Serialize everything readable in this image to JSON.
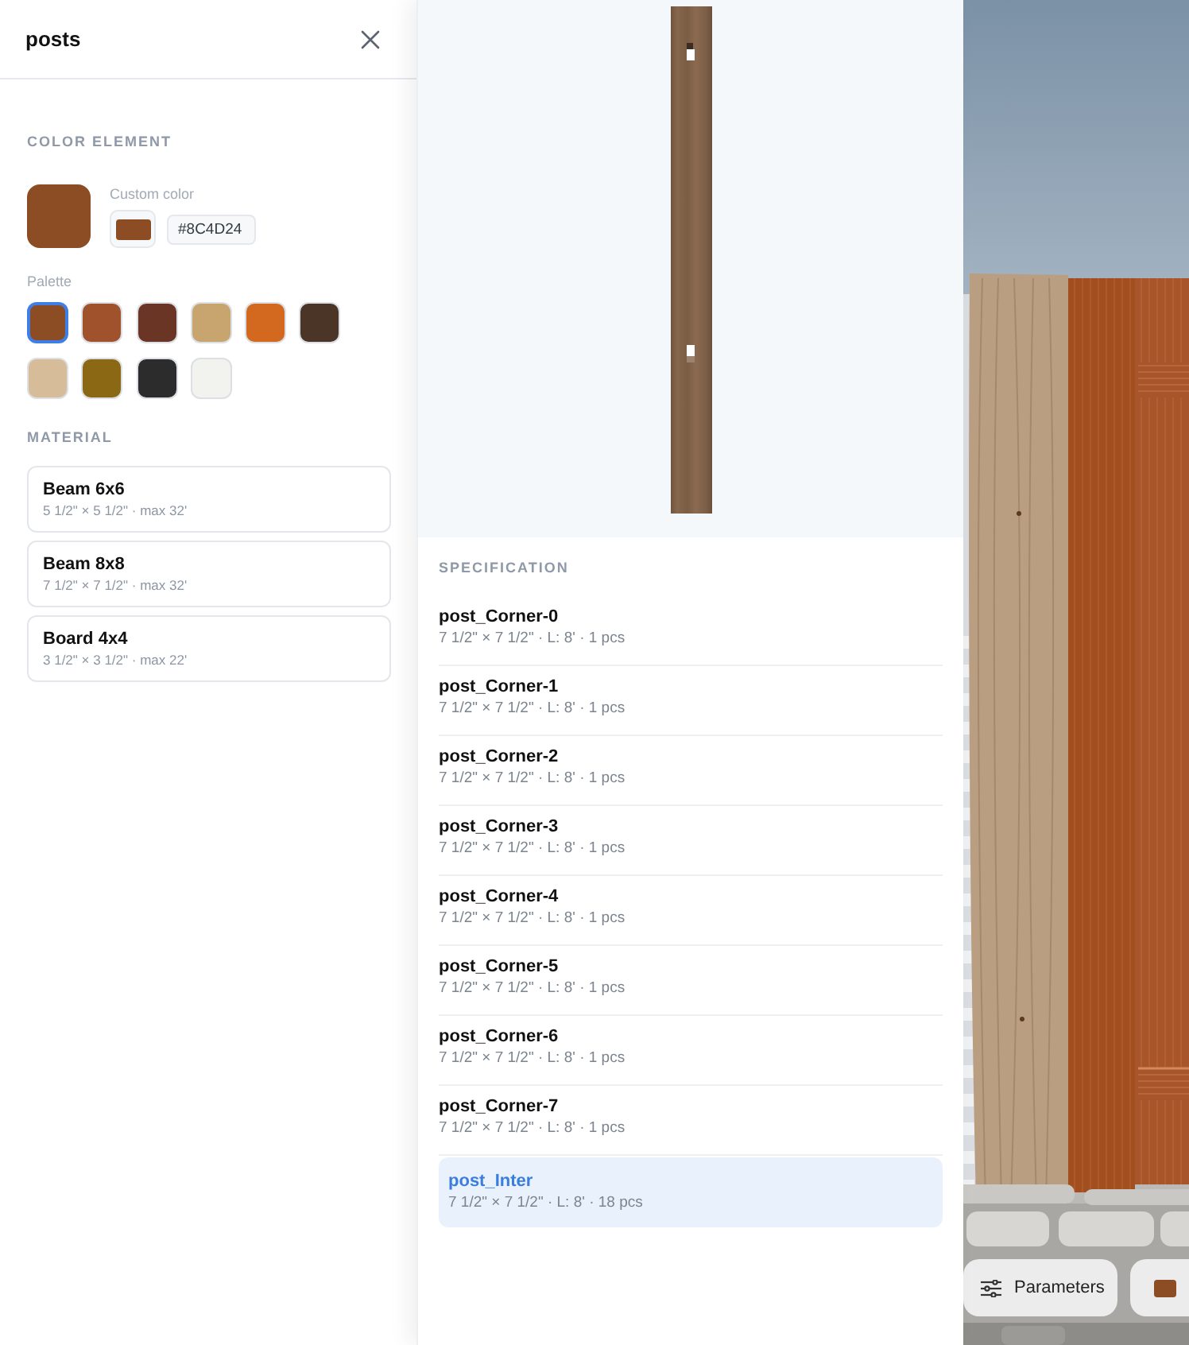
{
  "panel": {
    "title": "posts"
  },
  "color_element": {
    "heading": "COLOR ELEMENT",
    "custom_color": {
      "label": "Custom color",
      "value": "#8C4D24"
    },
    "palette": {
      "label": "Palette",
      "swatches": [
        {
          "color": "#8c4d24",
          "selected": true
        },
        {
          "color": "#a0522d",
          "selected": false
        },
        {
          "color": "#6b3526",
          "selected": false
        },
        {
          "color": "#c8a46e",
          "selected": false
        },
        {
          "color": "#d2691e",
          "selected": false
        },
        {
          "color": "#4a3526",
          "selected": false
        },
        {
          "color": "#d6bc98",
          "selected": false
        },
        {
          "color": "#8b6914",
          "selected": false
        },
        {
          "color": "#2c2c2c",
          "selected": false
        },
        {
          "color": "#f2f2ee",
          "selected": false
        }
      ]
    }
  },
  "material": {
    "heading": "MATERIAL",
    "items": [
      {
        "name": "Beam 6x6",
        "details": "5 1/2\" × 5 1/2\" · max 32'",
        "selected": false
      },
      {
        "name": "Beam 8x8",
        "details": "7 1/2\" × 7 1/2\" · max 32'",
        "selected": false
      },
      {
        "name": "Board 4x4",
        "details": "3 1/2\" × 3 1/2\" · max 22'",
        "selected": false
      }
    ]
  },
  "specification": {
    "heading": "SPECIFICATION",
    "items": [
      {
        "name": "post_Corner-0",
        "details": "7 1/2\" × 7 1/2\" · L: 8' · 1 pcs",
        "selected": false
      },
      {
        "name": "post_Corner-1",
        "details": "7 1/2\" × 7 1/2\" · L: 8' · 1 pcs",
        "selected": false
      },
      {
        "name": "post_Corner-2",
        "details": "7 1/2\" × 7 1/2\" · L: 8' · 1 pcs",
        "selected": false
      },
      {
        "name": "post_Corner-3",
        "details": "7 1/2\" × 7 1/2\" · L: 8' · 1 pcs",
        "selected": false
      },
      {
        "name": "post_Corner-4",
        "details": "7 1/2\" × 7 1/2\" · L: 8' · 1 pcs",
        "selected": false
      },
      {
        "name": "post_Corner-5",
        "details": "7 1/2\" × 7 1/2\" · L: 8' · 1 pcs",
        "selected": false
      },
      {
        "name": "post_Corner-6",
        "details": "7 1/2\" × 7 1/2\" · L: 8' · 1 pcs",
        "selected": false
      },
      {
        "name": "post_Corner-7",
        "details": "7 1/2\" × 7 1/2\" · L: 8' · 1 pcs",
        "selected": false
      },
      {
        "name": "post_Inter",
        "details": "7 1/2\" × 7 1/2\" · L: 8' · 18 pcs",
        "selected": true
      }
    ]
  },
  "viewport": {
    "buttons": [
      {
        "kind": "text",
        "label": "Parameters"
      },
      {
        "kind": "color"
      }
    ]
  }
}
